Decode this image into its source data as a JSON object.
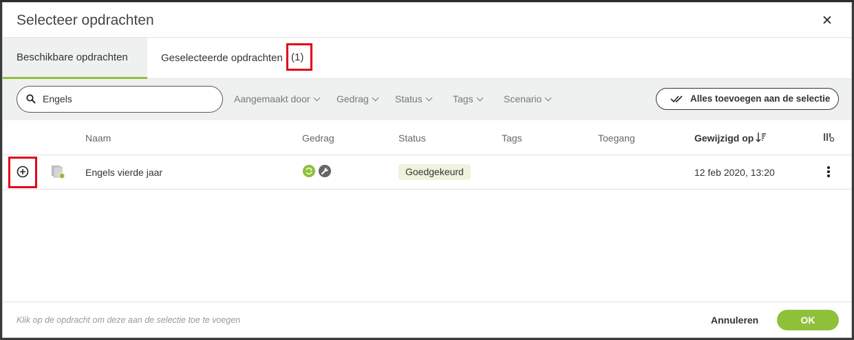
{
  "dialog": {
    "title": "Selecteer opdrachten"
  },
  "tabs": {
    "available": "Beschikbare opdrachten",
    "selected": "Geselecteerde opdrachten",
    "selected_count": "(1)"
  },
  "filters": {
    "search_value": "Engels",
    "items": [
      "Aangemaakt door",
      "Gedrag",
      "Status",
      "Tags",
      "Scenario"
    ],
    "add_all_label": "Alles toevoegen aan de selectie"
  },
  "table": {
    "columns": [
      "Naam",
      "Gedrag",
      "Status",
      "Tags",
      "Toegang",
      "Gewijzigd op"
    ],
    "rows": [
      {
        "name": "Engels vierde jaar",
        "behaviors": [
          "sync-icon",
          "wrench-icon"
        ],
        "status": "Goedgekeurd",
        "tags": "",
        "access": "",
        "modified": "12 feb 2020, 13:20"
      }
    ]
  },
  "footer": {
    "hint": "Klik op de opdracht om deze aan de selectie toe te voegen",
    "cancel_label": "Annuleren",
    "ok_label": "OK"
  },
  "colors": {
    "accent": "#8fc03a",
    "highlight": "#e0001a",
    "status_bg": "#eef4dc"
  }
}
